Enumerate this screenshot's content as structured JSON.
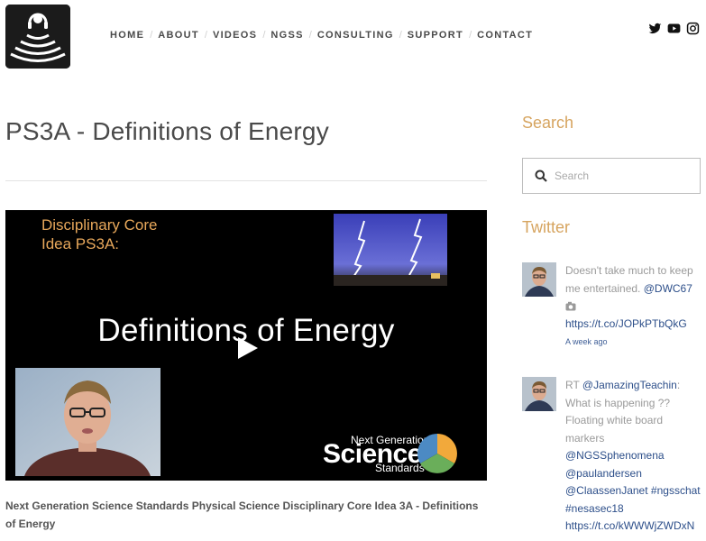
{
  "header": {
    "nav": [
      "HOME",
      "ABOUT",
      "VIDEOS",
      "NGSS",
      "CONSULTING",
      "SUPPORT",
      "CONTACT"
    ],
    "social_icons": [
      "twitter-icon",
      "youtube-icon",
      "instagram-icon"
    ]
  },
  "main": {
    "title": "PS3A - Definitions of Energy",
    "video": {
      "dci_line1": "Disciplinary Core",
      "dci_line2": "Idea PS3A:",
      "big_title": "Definitions of Energy",
      "ngss_small": "Next Generation",
      "ngss_big": "Science",
      "ngss_std": "Standards"
    },
    "caption": "Next Generation Science Standards Physical Science Disciplinary Core Idea 3A - Definitions of Energy"
  },
  "sidebar": {
    "search_heading": "Search",
    "search_placeholder": "Search",
    "twitter_heading": "Twitter",
    "tweets": [
      {
        "text_before": "Doesn't take much to keep me entertained. ",
        "mention": "@DWC67",
        "link": "https://t.co/JOPkPTbQkG",
        "time": "A week ago"
      },
      {
        "prefix": "RT ",
        "mention": "@JamazingTeachin",
        "text": ": What is happening ?? Floating white board markers",
        "mentions": [
          "@NGSSphenomena",
          "@paulandersen",
          "@ClaassenJanet",
          "#ngsschat",
          "#nesasec18"
        ],
        "link": "https://t.co/kWWWjZWDxN"
      }
    ]
  },
  "colors": {
    "accent_heading": "#d6a45f",
    "link": "#2d4f8a"
  }
}
